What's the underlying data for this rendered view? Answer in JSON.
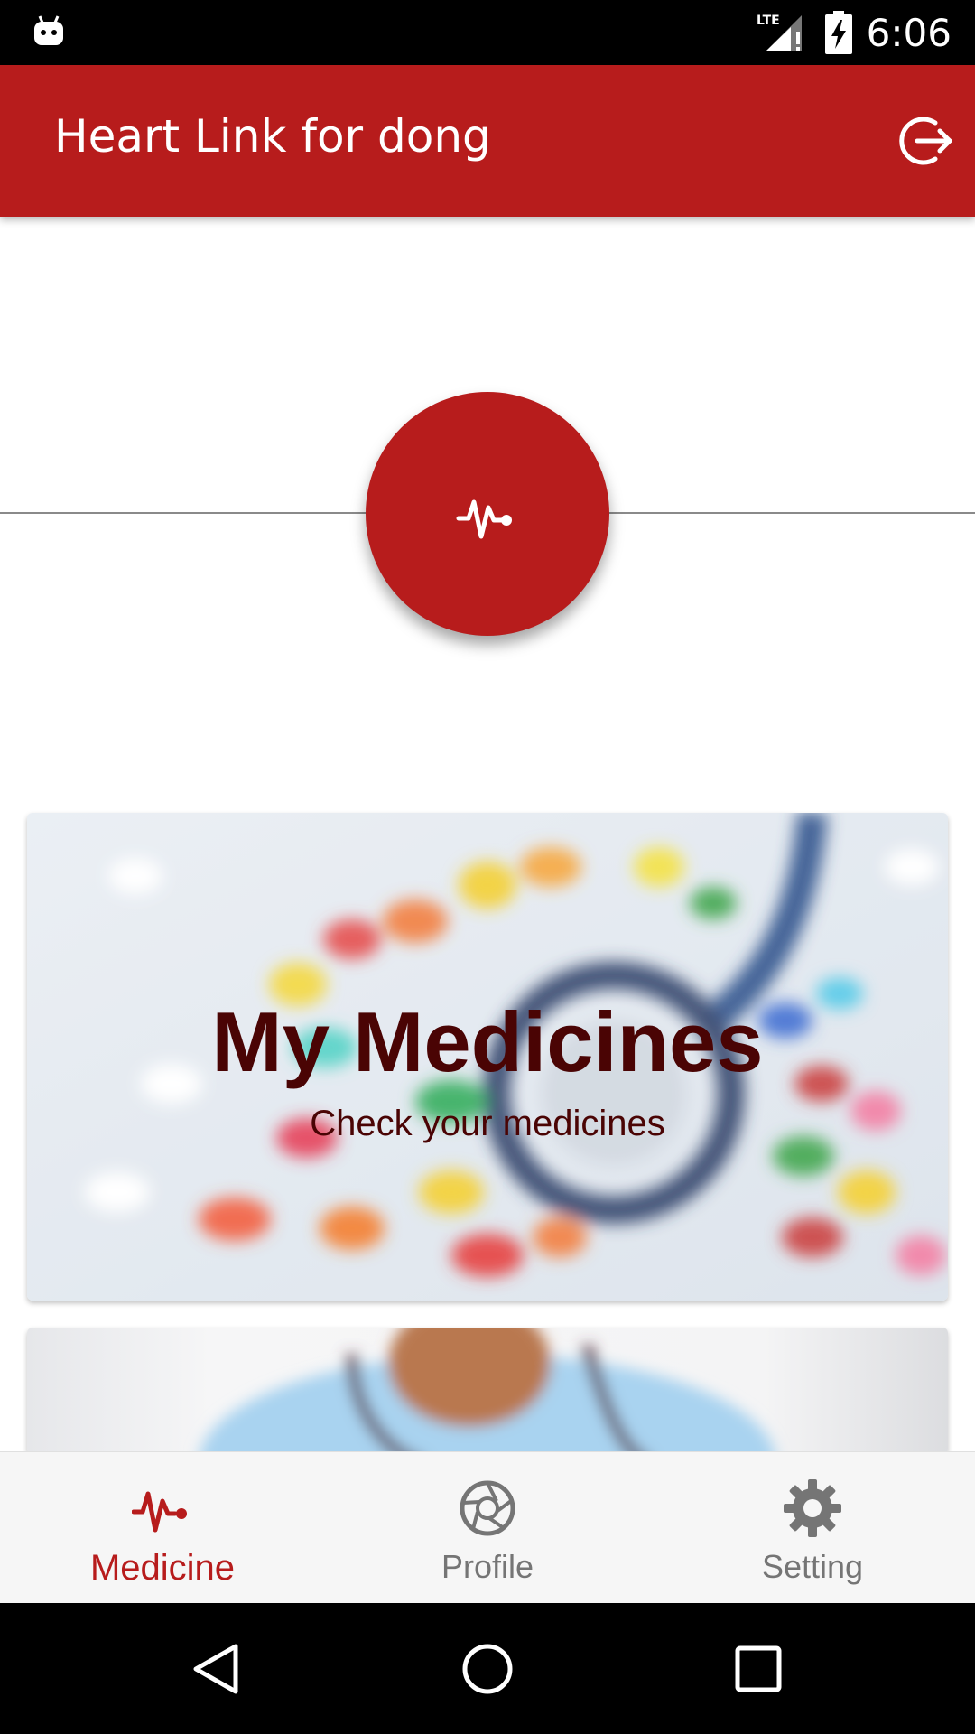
{
  "status_bar": {
    "time": "6:06",
    "network": "LTE",
    "icons": [
      "android-icon",
      "lte-signal-icon",
      "battery-charging-icon"
    ]
  },
  "app_bar": {
    "title": "Heart Link for dong",
    "action_icon": "logout-icon"
  },
  "fab": {
    "icon": "heartbeat-icon"
  },
  "cards": [
    {
      "title": "My Medicines",
      "subtitle": "Check your medicines",
      "image": "pills-and-stethoscope"
    },
    {
      "title": "",
      "subtitle": "",
      "image": "doctor-with-stethoscope"
    }
  ],
  "bottom_nav": {
    "items": [
      {
        "label": "Medicine",
        "icon": "heartbeat-icon",
        "active": true
      },
      {
        "label": "Profile",
        "icon": "aperture-icon",
        "active": false
      },
      {
        "label": "Setting",
        "icon": "gear-icon",
        "active": false
      }
    ]
  },
  "system_nav": {
    "buttons": [
      "back-icon",
      "home-icon",
      "recents-icon"
    ]
  },
  "colors": {
    "primary": "#b71c1c",
    "nav_inactive": "#757575",
    "card_text": "#4a0404"
  }
}
